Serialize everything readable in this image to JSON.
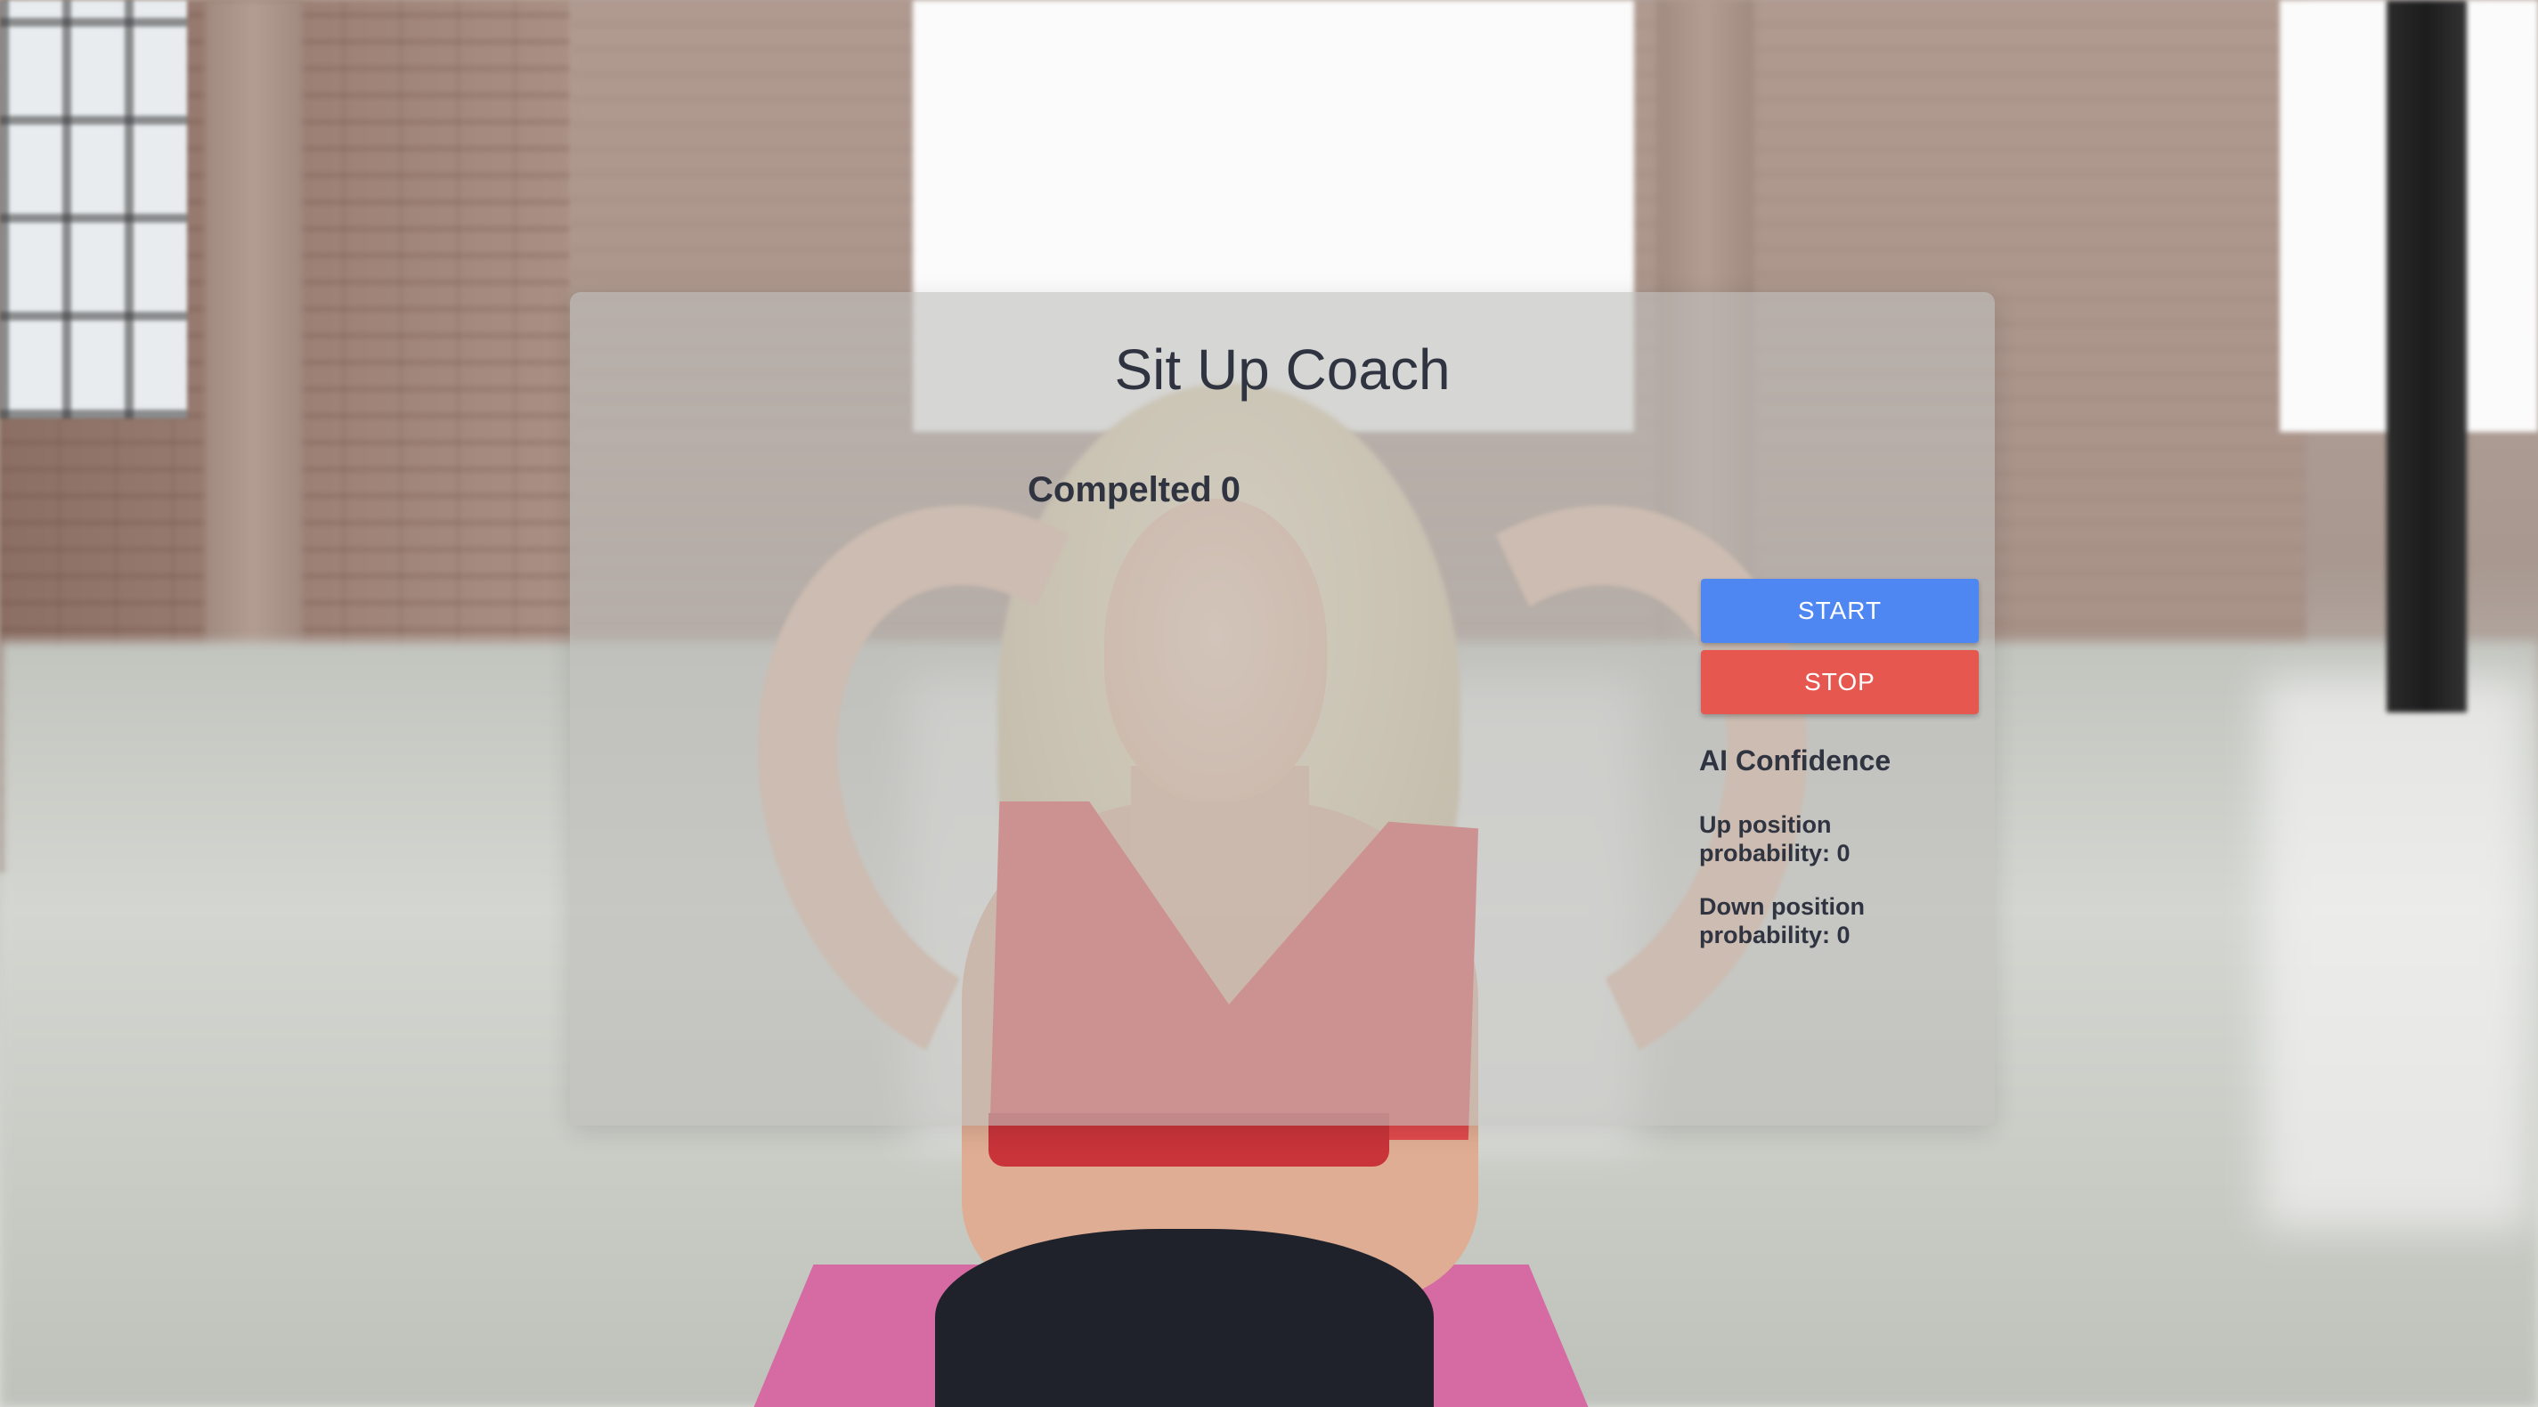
{
  "app": {
    "title": "Sit Up Coach"
  },
  "counter": {
    "label": "Compelted",
    "value": "0"
  },
  "controls": {
    "start_label": "START",
    "stop_label": "STOP"
  },
  "confidence": {
    "heading": "AI Confidence",
    "up": {
      "line1": "Up position",
      "line2_label": "probability:",
      "value": "0"
    },
    "down": {
      "line1": "Down position",
      "line2_label": "probability:",
      "value": "0"
    }
  },
  "colors": {
    "start": "#4f87f2",
    "stop": "#e65750",
    "text": "#2f3440"
  }
}
